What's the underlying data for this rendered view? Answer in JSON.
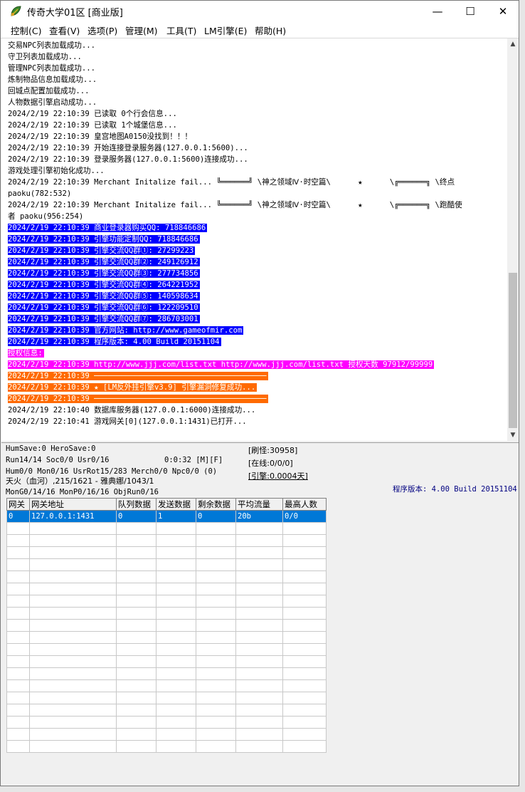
{
  "window": {
    "title": "传奇大学01区 [商业版]",
    "buttons": {
      "minimize": "—",
      "maximize": "☐",
      "close": "✕"
    }
  },
  "menu": [
    {
      "label": "控制(C)"
    },
    {
      "label": "查看(V)"
    },
    {
      "label": "选项(P)"
    },
    {
      "label": "管理(M)"
    },
    {
      "label": "工具(T)"
    },
    {
      "label": "LM引擎(E)"
    },
    {
      "label": "帮助(H)"
    }
  ],
  "colors": {
    "blue_highlight": "#0000ff",
    "magenta_highlight": "#ff00ff",
    "orange_highlight": "#ff6a00",
    "selection": "#0078d7"
  },
  "log_lines": [
    {
      "text": "交易NPC列表加载成功...",
      "style": "plain"
    },
    {
      "text": "守卫列表加载成功...",
      "style": "plain"
    },
    {
      "text": "管理NPC列表加载成功...",
      "style": "plain"
    },
    {
      "text": "炼制物品信息加载成功...",
      "style": "plain"
    },
    {
      "text": "回城点配置加载成功...",
      "style": "plain"
    },
    {
      "text": "人物数据引擎启动成功...",
      "style": "plain"
    },
    {
      "text": "2024/2/19 22:10:39 已读取 0个行会信息...",
      "style": "plain"
    },
    {
      "text": "2024/2/19 22:10:39 已读取 1个城堡信息...",
      "style": "plain"
    },
    {
      "text": "2024/2/19 22:10:39 皇宫地图A0150没找到！！！",
      "style": "plain"
    },
    {
      "text": "2024/2/19 22:10:39 开始连接登录服务器(127.0.0.1:5600)...",
      "style": "plain"
    },
    {
      "text": "2024/2/19 22:10:39 登录服务器(127.0.0.1:5600)连接成功...",
      "style": "plain"
    },
    {
      "text": "游戏处理引擎初始化成功...",
      "style": "plain"
    },
    {
      "text": "2024/2/19 22:10:39 Merchant Initalize fail... ╚══════╝ \\神之领域Ⅳ·时空篇\\      ★      \\╔══════╗ \\终点",
      "style": "plain"
    },
    {
      "text": "paoku(782:532)",
      "style": "plain"
    },
    {
      "text": "2024/2/19 22:10:39 Merchant Initalize fail... ╚══════╝ \\神之领域Ⅳ·时空篇\\      ★      \\╔══════╗ \\跑酷使",
      "style": "plain"
    },
    {
      "text": "者 paoku(956:254)",
      "style": "plain"
    },
    {
      "text": "2024/2/19 22:10:39 商业登录器购买QQ: 718846686",
      "style": "blue"
    },
    {
      "text": "2024/2/19 22:10:39 引擎功能定制QQ: 718846686",
      "style": "blue"
    },
    {
      "text": "2024/2/19 22:10:39 引擎交流QQ群①: 27299223",
      "style": "blue"
    },
    {
      "text": "2024/2/19 22:10:39 引擎交流QQ群②: 249126912",
      "style": "blue"
    },
    {
      "text": "2024/2/19 22:10:39 引擎交流QQ群③: 277734856",
      "style": "blue"
    },
    {
      "text": "2024/2/19 22:10:39 引擎交流QQ群④: 264221952",
      "style": "blue"
    },
    {
      "text": "2024/2/19 22:10:39 引擎交流QQ群⑤: 140598634",
      "style": "blue"
    },
    {
      "text": "2024/2/19 22:10:39 引擎交流QQ群⑥: 122209510",
      "style": "blue"
    },
    {
      "text": "2024/2/19 22:10:39 引擎交流QQ群⑦: 286703001",
      "style": "blue"
    },
    {
      "text": "2024/2/19 22:10:39 官方网站: http://www.gameofmir.com",
      "style": "blue"
    },
    {
      "text": "2024/2/19 22:10:39 程序版本: 4.00 Build 20151104",
      "style": "blue"
    },
    {
      "text": "授权信息:",
      "style": "magenta"
    },
    {
      "text": "2024/2/19 22:10:39 http://www.jjj.com/list.txt http://www.jjj.com/list.txt 授权天数 97912/99999",
      "style": "magenta"
    },
    {
      "text": "2024/2/19 22:10:39 ──────────────────────────────────────",
      "style": "orange"
    },
    {
      "text": "2024/2/19 22:10:39 ★ [LM反外挂引擎v3.9] 引擎漏洞修复成功...",
      "style": "orange"
    },
    {
      "text": "2024/2/19 22:10:39 ──────────────────────────────────────",
      "style": "orange"
    },
    {
      "text": "2024/2/19 22:10:40 数据库服务器(127.0.0.1:6000)连接成功...",
      "style": "plain"
    },
    {
      "text": "2024/2/19 22:10:41 游戏网关[0](127.0.0.1:1431)已打开...",
      "style": "plain"
    }
  ],
  "status": {
    "line1": "HumSave:0 HeroSave:0",
    "line2": "Run14/14 Soc0/0 Usr0/16",
    "line2_time": "0:0:32 [M][F]",
    "line3": "Hum0/0 Mon0/16 UsrRot15/283 Merch0/0 Npc0/0 (0)",
    "line4": "天火（血河）,215/1621 - 雅典娜/1043/1",
    "line5": "MonG0/14/16 MonP0/16/16 ObjRun0/16",
    "monster_refresh": "[刷怪:30958]",
    "online": "[在线:0/0/0]",
    "engine": "[引擎:0.0004天]",
    "version": "程序版本: 4.00 Build 20151104"
  },
  "gateway_table": {
    "columns": [
      "网关",
      "网关地址",
      "队列数据",
      "发送数据",
      "剩余数据",
      "平均流量",
      "最高人数"
    ],
    "rows": [
      [
        "0",
        "127.0.0.1:1431",
        "0",
        "1",
        "0",
        "20b",
        "0/0"
      ]
    ],
    "empty_rows": 19
  }
}
